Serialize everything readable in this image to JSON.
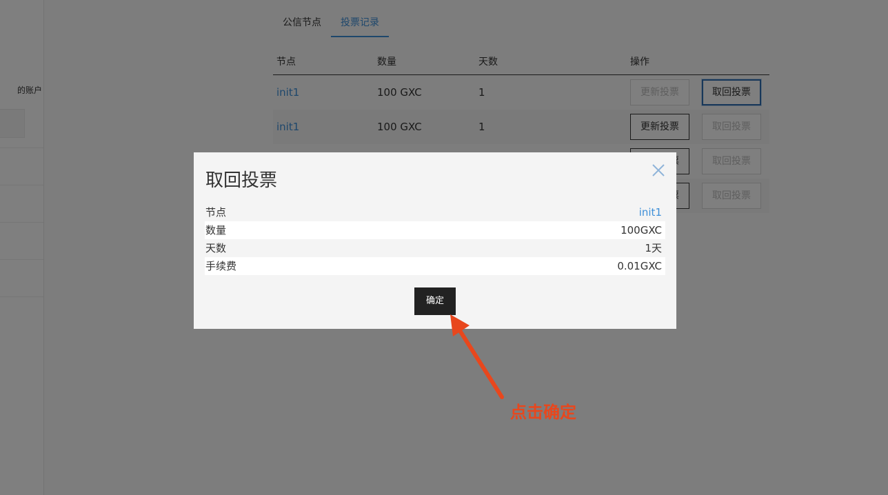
{
  "sidebar": {
    "account_label": "的账户"
  },
  "tabs": [
    {
      "label": "公信节点",
      "active": false
    },
    {
      "label": "投票记录",
      "active": true
    }
  ],
  "vote_table": {
    "headers": [
      "节点",
      "数量",
      "天数",
      "操作"
    ],
    "rows": [
      {
        "node": "init1",
        "amount": "100 GXC",
        "days": "1",
        "update_label": "更新投票",
        "withdraw_label": "取回投票",
        "update_enabled": false,
        "withdraw_enabled": true
      },
      {
        "node": "init1",
        "amount": "100 GXC",
        "days": "1",
        "update_label": "更新投票",
        "withdraw_label": "取回投票",
        "update_enabled": true,
        "withdraw_enabled": false
      },
      {
        "update_label": "更新投票",
        "withdraw_label": "取回投票",
        "update_enabled": true,
        "withdraw_enabled": false
      },
      {
        "update_label": "更新投票",
        "withdraw_label": "取回投票",
        "update_enabled": true,
        "withdraw_enabled": false
      }
    ]
  },
  "modal": {
    "title": "取回投票",
    "close_icon": "close-icon",
    "details": [
      {
        "label": "节点",
        "value": "init1"
      },
      {
        "label": "数量",
        "value": "100GXC"
      },
      {
        "label": "天数",
        "value": "1天"
      },
      {
        "label": "手续费",
        "value": "0.01GXC"
      }
    ],
    "confirm_label": "确定"
  },
  "annotation": {
    "text": "点击确定",
    "color": "#e8471d"
  },
  "colors": {
    "accent": "#3d8fd8",
    "overlay": "rgba(0,0,0,0.5)",
    "primary_button": "#222222"
  }
}
